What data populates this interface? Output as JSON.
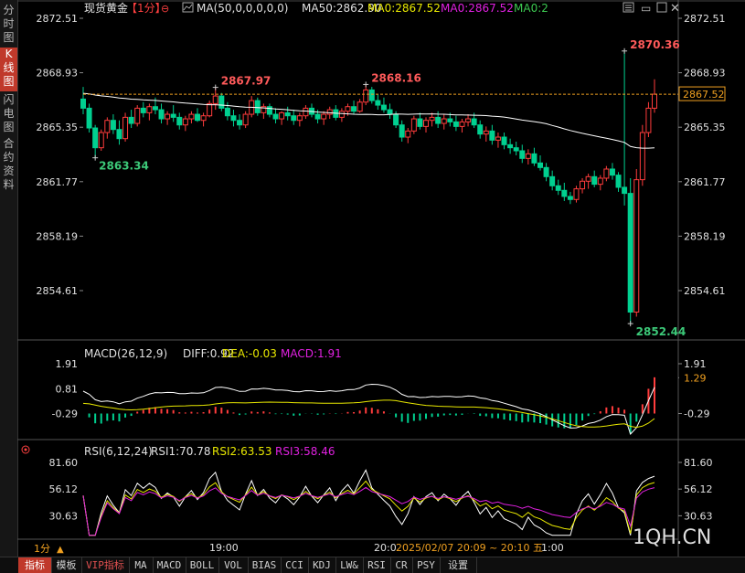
{
  "sidebar": {
    "tabs": [
      {
        "label": "分时图",
        "active": false
      },
      {
        "label": "K线图",
        "active": true
      },
      {
        "label": "闪电图",
        "active": false
      },
      {
        "label": "合约资料",
        "active": false
      }
    ]
  },
  "header": {
    "symbol": "现货黄金",
    "period": "【1分】",
    "ma_params": "MA(50,0,0,0,0,0)",
    "ma50": "MA50:2862.90",
    "ma0_a": "MA0:2867.52",
    "ma0_b": "MA0:2867.52",
    "ma0_c": "MA0:2"
  },
  "colors": {
    "up": "#ff3c3c",
    "down": "#00d090",
    "ma": "#ffffff",
    "yellow": "#e8e800",
    "magenta": "#e020e0",
    "green_label": "#3cc850",
    "price_label": "#ff5a5a",
    "low_label": "#3cc878",
    "grid_axis": "#555555"
  },
  "axis": {
    "price_ticks": [
      "2872.51",
      "2868.93",
      "2865.35",
      "2861.77",
      "2858.19",
      "2854.61"
    ],
    "macd_ticks": [
      "1.91",
      "0.81",
      "-0.29"
    ],
    "rsi_ticks": [
      "81.60",
      "56.12",
      "30.63"
    ],
    "macd_right_ticks": [
      "1.91",
      "1.29",
      "-0.29"
    ],
    "rsi_right_ticks": [
      "81.60",
      "56.12",
      "30.63"
    ],
    "x_labels": [
      "19:00",
      "20:0"
    ],
    "current_price_label": "2867.52",
    "time_range": "2025/02/07  20:09 ~ 20:10 五",
    "time_after": "1:00"
  },
  "macd_header": {
    "name": "MACD(26,12,9)",
    "diff": "DIFF:0.92",
    "dea": "DEA:-0.03",
    "macd": "MACD:1.91"
  },
  "rsi_header": {
    "name": "RSI(6,12,24)",
    "rsi1": "RSI1:70.78",
    "rsi2": "RSI2:63.53",
    "rsi3": "RSI3:58.46"
  },
  "annotations": {
    "high1": "2867.97",
    "high2": "2868.16",
    "high3": "2870.36",
    "low1": "2863.34",
    "low2": "2852.44"
  },
  "watermark": "1QH.CN",
  "period_selector": "1分",
  "bottom_tabs": [
    {
      "label": "指标",
      "active": true,
      "vip": false
    },
    {
      "label": "模板",
      "active": false,
      "vip": false
    },
    {
      "label": "VIP指标",
      "active": false,
      "vip": true
    },
    {
      "label": "MA",
      "active": false,
      "vip": false
    },
    {
      "label": "MACD",
      "active": false,
      "vip": false
    },
    {
      "label": "BOLL",
      "active": false,
      "vip": false
    },
    {
      "label": "VOL",
      "active": false,
      "vip": false
    },
    {
      "label": "BIAS",
      "active": false,
      "vip": false
    },
    {
      "label": "CCI",
      "active": false,
      "vip": false
    },
    {
      "label": "KDJ",
      "active": false,
      "vip": false
    },
    {
      "label": "LW&",
      "active": false,
      "vip": false
    },
    {
      "label": "RSI",
      "active": false,
      "vip": false
    },
    {
      "label": "CR",
      "active": false,
      "vip": false
    },
    {
      "label": "PSY",
      "active": false,
      "vip": false
    },
    {
      "label": "设置",
      "active": false,
      "vip": false
    }
  ],
  "chart_data": {
    "type": "candlestick",
    "title": "现货黄金【1分】",
    "ylim": [
      2851.5,
      2873.5
    ],
    "ma50_last": 2862.9,
    "current_price": 2867.52,
    "key_levels": {
      "day_high": 2870.36,
      "day_low": 2852.44,
      "high_a": 2867.97,
      "high_b": 2868.16,
      "low_a": 2863.34
    },
    "candles": [
      [
        2867.2,
        2868.0,
        2866.2,
        2866.6
      ],
      [
        2866.6,
        2866.9,
        2865.0,
        2865.3
      ],
      [
        2865.3,
        2865.5,
        2863.3,
        2864.0
      ],
      [
        2864.0,
        2865.2,
        2863.8,
        2865.0
      ],
      [
        2865.0,
        2866.0,
        2864.6,
        2865.8
      ],
      [
        2865.8,
        2866.2,
        2864.9,
        2865.2
      ],
      [
        2865.2,
        2865.8,
        2864.2,
        2864.6
      ],
      [
        2864.6,
        2866.3,
        2864.4,
        2866.0
      ],
      [
        2866.0,
        2866.5,
        2865.3,
        2865.6
      ],
      [
        2865.6,
        2866.8,
        2865.4,
        2866.6
      ],
      [
        2866.6,
        2867.0,
        2866.0,
        2866.3
      ],
      [
        2866.3,
        2866.9,
        2865.8,
        2866.7
      ],
      [
        2866.7,
        2867.3,
        2866.2,
        2866.5
      ],
      [
        2866.5,
        2866.9,
        2865.6,
        2865.9
      ],
      [
        2865.9,
        2866.4,
        2865.5,
        2866.2
      ],
      [
        2866.2,
        2866.8,
        2865.7,
        2866.0
      ],
      [
        2866.0,
        2866.3,
        2865.2,
        2865.5
      ],
      [
        2865.5,
        2866.1,
        2865.1,
        2865.9
      ],
      [
        2865.9,
        2866.4,
        2865.6,
        2866.2
      ],
      [
        2866.2,
        2866.6,
        2865.7,
        2865.8
      ],
      [
        2865.8,
        2866.3,
        2865.4,
        2866.1
      ],
      [
        2866.1,
        2867.1,
        2866.0,
        2866.9
      ],
      [
        2866.9,
        2867.97,
        2866.5,
        2867.4
      ],
      [
        2867.4,
        2867.6,
        2866.4,
        2866.6
      ],
      [
        2866.6,
        2867.0,
        2865.8,
        2866.1
      ],
      [
        2866.1,
        2866.5,
        2865.4,
        2865.8
      ],
      [
        2865.8,
        2866.2,
        2865.2,
        2865.5
      ],
      [
        2865.5,
        2866.4,
        2865.3,
        2866.2
      ],
      [
        2866.2,
        2867.4,
        2866.0,
        2867.1
      ],
      [
        2867.1,
        2867.3,
        2866.1,
        2866.3
      ],
      [
        2866.3,
        2866.9,
        2865.9,
        2866.7
      ],
      [
        2866.7,
        2866.9,
        2866.0,
        2866.2
      ],
      [
        2866.2,
        2866.6,
        2865.6,
        2865.9
      ],
      [
        2865.9,
        2866.4,
        2865.5,
        2866.3
      ],
      [
        2866.3,
        2866.7,
        2865.8,
        2866.1
      ],
      [
        2866.1,
        2866.5,
        2865.5,
        2865.8
      ],
      [
        2865.8,
        2866.3,
        2865.4,
        2866.1
      ],
      [
        2866.1,
        2866.8,
        2865.9,
        2866.6
      ],
      [
        2866.6,
        2866.9,
        2866.0,
        2866.2
      ],
      [
        2866.2,
        2866.5,
        2865.6,
        2865.9
      ],
      [
        2865.9,
        2866.4,
        2865.5,
        2866.2
      ],
      [
        2866.2,
        2866.7,
        2865.9,
        2866.5
      ],
      [
        2866.5,
        2866.8,
        2865.8,
        2866.0
      ],
      [
        2866.0,
        2866.6,
        2865.7,
        2866.4
      ],
      [
        2866.4,
        2866.9,
        2866.1,
        2866.7
      ],
      [
        2866.7,
        2867.1,
        2866.2,
        2866.4
      ],
      [
        2866.4,
        2867.2,
        2866.3,
        2867.0
      ],
      [
        2867.0,
        2868.16,
        2866.8,
        2867.8
      ],
      [
        2867.8,
        2868.0,
        2866.9,
        2867.1
      ],
      [
        2867.1,
        2867.5,
        2866.5,
        2866.8
      ],
      [
        2866.8,
        2867.3,
        2866.3,
        2866.5
      ],
      [
        2866.5,
        2866.9,
        2865.9,
        2866.2
      ],
      [
        2866.2,
        2866.4,
        2865.3,
        2865.5
      ],
      [
        2865.5,
        2865.8,
        2864.4,
        2864.7
      ],
      [
        2864.7,
        2865.3,
        2864.3,
        2865.1
      ],
      [
        2865.1,
        2866.1,
        2864.9,
        2865.9
      ],
      [
        2865.9,
        2866.3,
        2865.2,
        2865.4
      ],
      [
        2865.4,
        2866.0,
        2865.0,
        2865.8
      ],
      [
        2865.8,
        2866.3,
        2865.4,
        2866.0
      ],
      [
        2866.0,
        2866.4,
        2865.3,
        2865.6
      ],
      [
        2865.6,
        2866.2,
        2865.2,
        2865.9
      ],
      [
        2865.9,
        2866.3,
        2865.4,
        2865.7
      ],
      [
        2865.7,
        2866.1,
        2865.1,
        2865.4
      ],
      [
        2865.4,
        2865.9,
        2865.0,
        2865.7
      ],
      [
        2865.7,
        2866.2,
        2865.4,
        2865.9
      ],
      [
        2865.9,
        2866.3,
        2865.3,
        2865.5
      ],
      [
        2865.5,
        2865.8,
        2864.6,
        2864.9
      ],
      [
        2864.9,
        2865.4,
        2864.4,
        2865.1
      ],
      [
        2865.1,
        2865.5,
        2864.2,
        2864.5
      ],
      [
        2864.5,
        2865.0,
        2864.0,
        2864.7
      ],
      [
        2864.7,
        2865.0,
        2863.9,
        2864.2
      ],
      [
        2864.2,
        2864.6,
        2863.6,
        2864.0
      ],
      [
        2864.0,
        2864.4,
        2863.5,
        2863.8
      ],
      [
        2863.8,
        2864.2,
        2863.0,
        2863.3
      ],
      [
        2863.3,
        2863.9,
        2862.9,
        2863.6
      ],
      [
        2863.6,
        2864.0,
        2862.8,
        2863.0
      ],
      [
        2863.0,
        2863.5,
        2862.5,
        2862.7
      ],
      [
        2862.7,
        2863.0,
        2861.8,
        2862.1
      ],
      [
        2862.1,
        2862.5,
        2861.2,
        2861.5
      ],
      [
        2861.5,
        2861.9,
        2860.9,
        2861.2
      ],
      [
        2861.2,
        2861.7,
        2860.5,
        2860.8
      ],
      [
        2860.8,
        2861.1,
        2860.3,
        2860.6
      ],
      [
        2860.6,
        2861.5,
        2860.4,
        2861.3
      ],
      [
        2861.3,
        2862.0,
        2861.0,
        2861.8
      ],
      [
        2861.8,
        2862.3,
        2861.3,
        2862.1
      ],
      [
        2862.1,
        2862.5,
        2861.4,
        2861.6
      ],
      [
        2861.6,
        2862.2,
        2861.2,
        2862.0
      ],
      [
        2862.0,
        2862.8,
        2861.8,
        2862.6
      ],
      [
        2862.6,
        2863.0,
        2861.9,
        2862.2
      ],
      [
        2862.2,
        2862.4,
        2861.1,
        2861.4
      ],
      [
        2861.4,
        2870.36,
        2860.2,
        2861.0
      ],
      [
        2861.0,
        2862.0,
        2852.44,
        2853.2
      ],
      [
        2853.2,
        2862.6,
        2852.9,
        2861.9
      ],
      [
        2861.9,
        2865.5,
        2861.5,
        2865.0
      ],
      [
        2865.0,
        2867.0,
        2864.7,
        2866.6
      ],
      [
        2866.6,
        2868.5,
        2866.3,
        2867.52
      ]
    ]
  }
}
